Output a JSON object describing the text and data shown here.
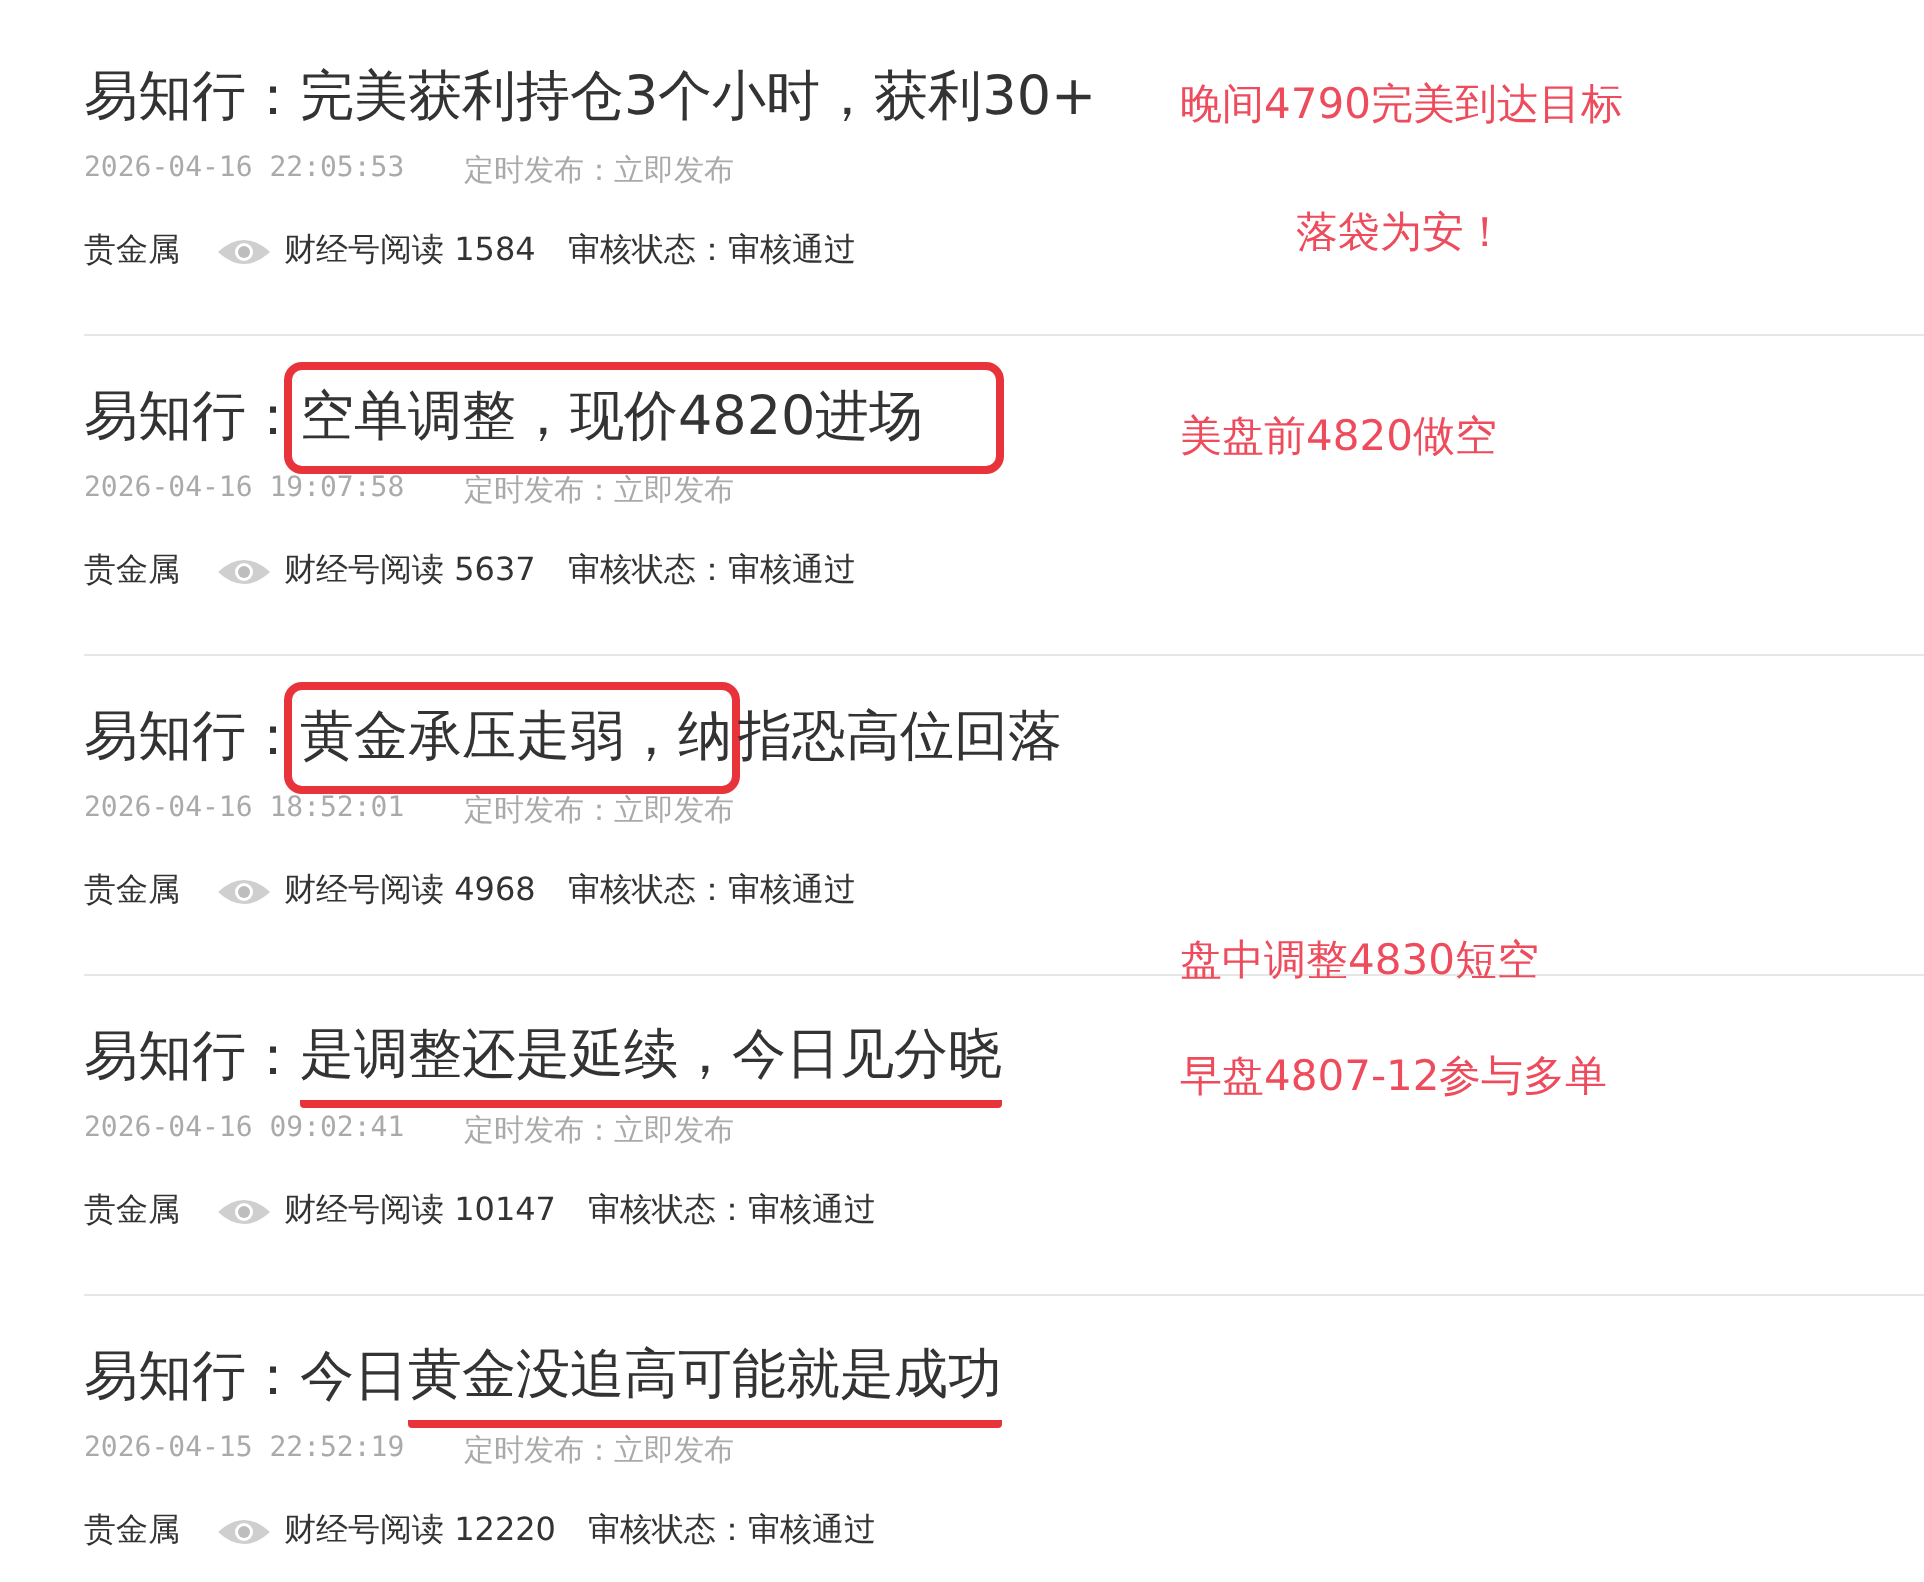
{
  "articles": [
    {
      "title": [
        {
          "text": "易知行：完美获利持仓3个小时，获利30+",
          "kind": "plain"
        }
      ],
      "date": "2026-04-16 22:05:53",
      "schedule": "定时发布：立即发布",
      "category": "贵金属",
      "reads": "财经号阅读 1584",
      "status": "审核状态：审核通过",
      "notes": [
        "晚间4790完美到达目标",
        "落袋为安！"
      ]
    },
    {
      "title": [
        {
          "text": "易知行：",
          "kind": "plain"
        },
        {
          "text": "空单调整，现价4820进场",
          "kind": "box"
        }
      ],
      "date": "2026-04-16 19:07:58",
      "schedule": "定时发布：立即发布",
      "category": "贵金属",
      "reads": "财经号阅读 5637",
      "status": "审核状态：审核通过",
      "notes": [
        "美盘前4820做空"
      ]
    },
    {
      "title": [
        {
          "text": "易知行：",
          "kind": "plain"
        },
        {
          "text": "黄金承压走弱，纳",
          "kind": "box"
        },
        {
          "text": "指恐高位回落",
          "kind": "plain"
        }
      ],
      "date": "2026-04-16 18:52:01",
      "schedule": "定时发布：立即发布",
      "category": "贵金属",
      "reads": "财经号阅读 4968",
      "status": "审核状态：审核通过"
    },
    {
      "title": [
        {
          "text": "易知行：",
          "kind": "plain"
        },
        {
          "text": "是调整还是延续，今日见分晓",
          "kind": "underline"
        }
      ],
      "date": "2026-04-16 09:02:41",
      "schedule": "定时发布：立即发布",
      "category": "贵金属",
      "reads": "财经号阅读 10147",
      "status": "审核状态：审核通过",
      "notes": [
        "盘中调整4830短空",
        "早盘4807-12参与多单"
      ]
    },
    {
      "title": [
        {
          "text": "易知行：今日",
          "kind": "plain"
        },
        {
          "text": "黄金没追高可能就是成功",
          "kind": "underline"
        }
      ],
      "date": "2026-04-15 22:52:19",
      "schedule": "定时发布：立即发布",
      "category": "贵金属",
      "reads": "财经号阅读 12220",
      "status": "审核状态：审核通过"
    }
  ]
}
